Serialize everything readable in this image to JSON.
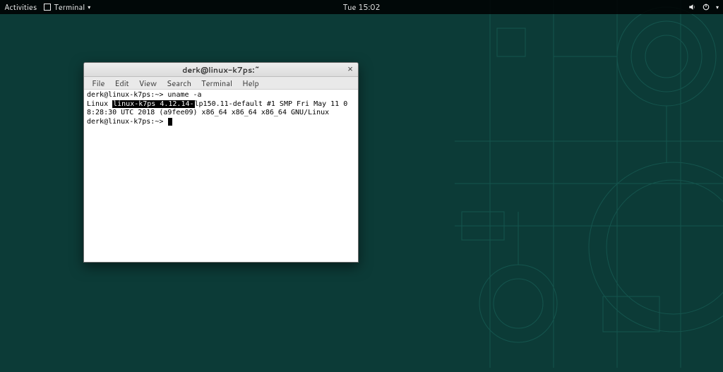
{
  "topbar": {
    "activities_label": "Activities",
    "app_name": "Terminal",
    "clock": "Tue 15:02"
  },
  "window": {
    "title": "derk@linux-k7ps:~"
  },
  "menubar": {
    "items": [
      "File",
      "Edit",
      "View",
      "Search",
      "Terminal",
      "Help"
    ]
  },
  "terminal": {
    "prompt": "derk@linux-k7ps:~>",
    "command": "uname -a",
    "output_leading": "Linux ",
    "output_highlight": "linux-k7ps 4.12.14-",
    "output_trailing": "lp150.11-default #1 SMP Fri May 11 08:28:30 UTC 2018 (a9fee09) x86_64 x86_64 x86_64 GNU/Linux",
    "prompt2": "derk@linux-k7ps:~>"
  }
}
